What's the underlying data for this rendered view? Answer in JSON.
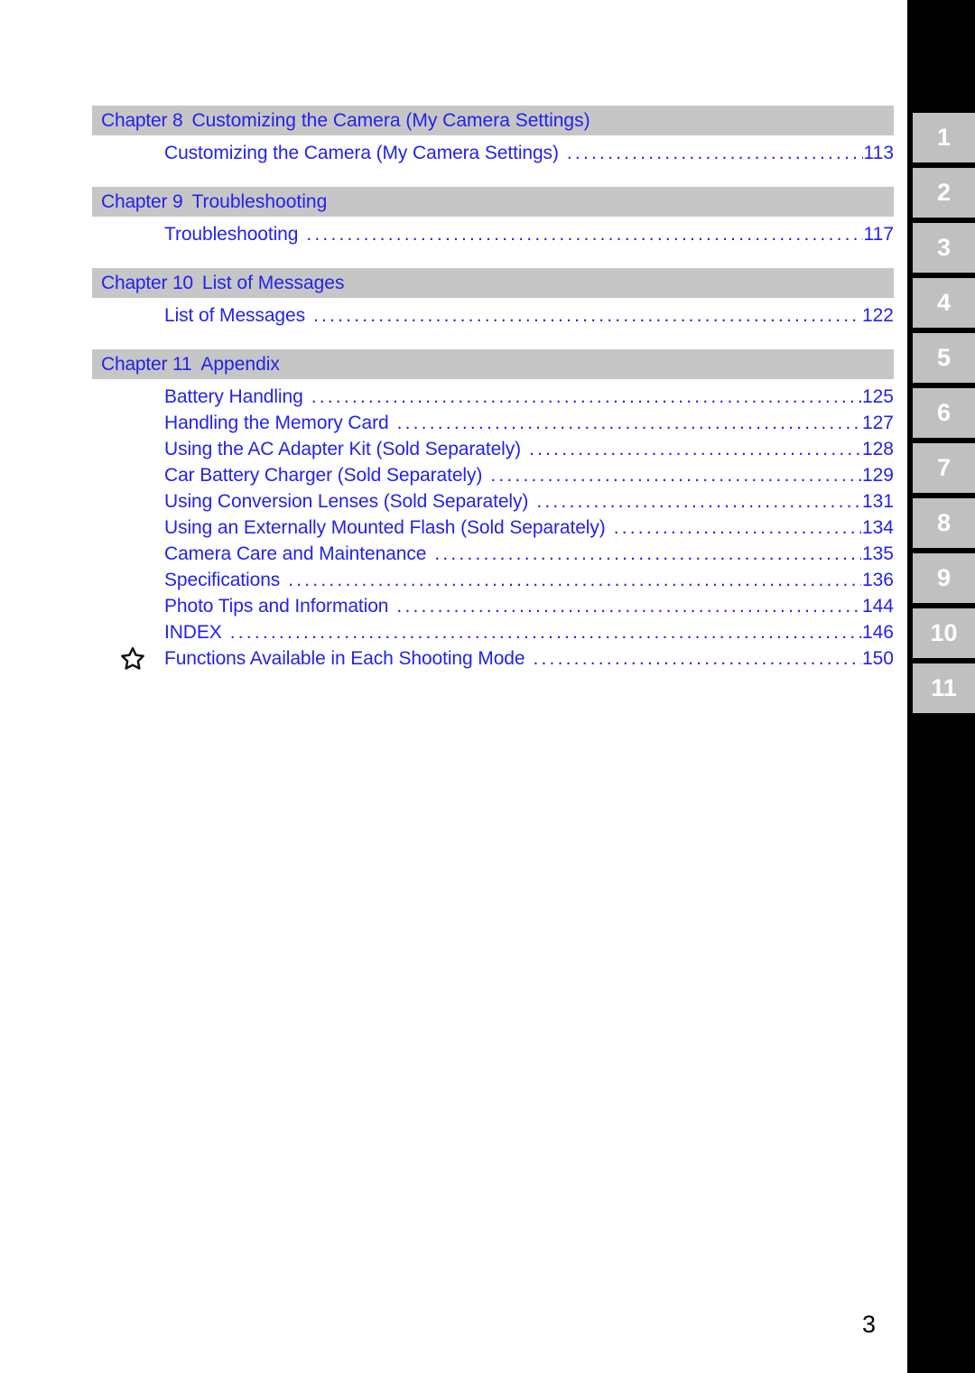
{
  "document": {
    "page_number": "3",
    "accent_color": "#2222ee",
    "chapter_bar_color": "#c6c6c6",
    "tab_rail_color": "#000000",
    "tab_chip_color": "#c0c0c0"
  },
  "sections": [
    {
      "chapter_label": "Chapter 8",
      "chapter_title": "Customizing the Camera (My Camera Settings)",
      "entries": [
        {
          "title": "Customizing the Camera (My Camera Settings)",
          "page": "113",
          "star": false
        }
      ]
    },
    {
      "chapter_label": "Chapter 9",
      "chapter_title": "Troubleshooting",
      "entries": [
        {
          "title": "Troubleshooting",
          "page": "117",
          "star": false
        }
      ]
    },
    {
      "chapter_label": "Chapter 10",
      "chapter_title": "List of Messages",
      "entries": [
        {
          "title": "List of Messages",
          "page": "122",
          "star": false
        }
      ]
    },
    {
      "chapter_label": "Chapter 11",
      "chapter_title": "Appendix",
      "entries": [
        {
          "title": "Battery Handling",
          "page": "125",
          "star": false
        },
        {
          "title": "Handling the Memory Card",
          "page": "127",
          "star": false
        },
        {
          "title": "Using the AC Adapter Kit (Sold Separately)",
          "page": "128",
          "star": false
        },
        {
          "title": "Car Battery Charger (Sold Separately)",
          "page": "129",
          "star": false
        },
        {
          "title": "Using Conversion Lenses (Sold Separately)",
          "page": "131",
          "star": false
        },
        {
          "title": "Using an Externally Mounted Flash (Sold Separately)",
          "page": "134",
          "star": false
        },
        {
          "title": "Camera Care and Maintenance",
          "page": "135",
          "star": false
        },
        {
          "title": "Specifications",
          "page": "136",
          "star": false
        },
        {
          "title": "Photo Tips and Information",
          "page": "144",
          "star": false
        },
        {
          "title": "INDEX",
          "page": "146",
          "star": false
        },
        {
          "title": "Functions Available in Each Shooting Mode",
          "page": "150",
          "star": true
        }
      ]
    }
  ],
  "tab_rail": {
    "tabs": [
      {
        "label": "1"
      },
      {
        "label": "2"
      },
      {
        "label": "3"
      },
      {
        "label": "4"
      },
      {
        "label": "5"
      },
      {
        "label": "6"
      },
      {
        "label": "7"
      },
      {
        "label": "8"
      },
      {
        "label": "9"
      },
      {
        "label": "10"
      },
      {
        "label": "11"
      }
    ]
  }
}
